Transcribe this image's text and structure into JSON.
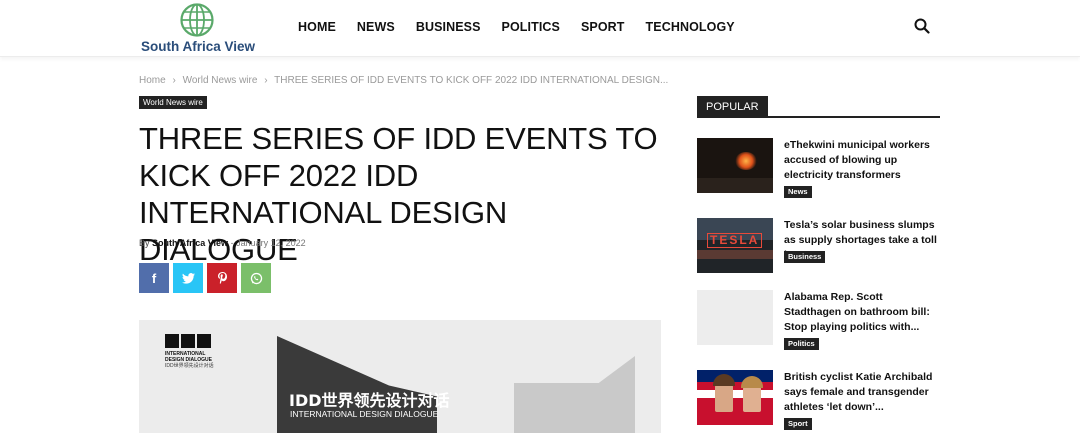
{
  "site": {
    "name": "South Africa View",
    "brand_color": "#2a4d7a",
    "globe_color": "#5aa96a"
  },
  "nav": {
    "items": [
      {
        "label": "HOME"
      },
      {
        "label": "NEWS"
      },
      {
        "label": "BUSINESS"
      },
      {
        "label": "POLITICS"
      },
      {
        "label": "SPORT"
      },
      {
        "label": "TECHNOLOGY"
      }
    ],
    "search_icon": "search-icon"
  },
  "breadcrumb": {
    "items": [
      "Home",
      "World News wire",
      "THREE SERIES OF IDD EVENTS TO KICK OFF 2022 IDD INTERNATIONAL DESIGN..."
    ],
    "separator": "›"
  },
  "article": {
    "category": "World News wire",
    "title": "THREE SERIES OF IDD EVENTS TO KICK OFF 2022 IDD INTERNATIONAL DESIGN DIALOGUE",
    "by_label": "By",
    "author": "South Africa View",
    "date_sep": "-",
    "date": "January 12, 2022",
    "share": [
      {
        "name": "facebook",
        "glyph": "f",
        "color": "#516eab"
      },
      {
        "name": "twitter",
        "glyph": "🐦",
        "color": "#29c5f6"
      },
      {
        "name": "pinterest",
        "glyph": "P",
        "color": "#ca212a"
      },
      {
        "name": "whatsapp",
        "glyph": "✆",
        "color": "#7bbf6a"
      }
    ],
    "feature_image": {
      "logo_line1": "INTERNATIONAL",
      "logo_line2": "DESIGN DIALOGUE",
      "logo_line3": "IDD世界领先设计对话",
      "headline_cn": "IDD世界领先设计对话",
      "headline_en": "INTERNATIONAL DESIGN DIALOGUE"
    }
  },
  "sidebar": {
    "heading": "POPULAR",
    "items": [
      {
        "title": "eThekwini municipal workers accused of blowing up electricity transformers",
        "tag": "News"
      },
      {
        "title": "Tesla’s solar business slumps as supply shortages take a toll |...",
        "tag": "Business",
        "thumb_text": "TESLA"
      },
      {
        "title": "Alabama Rep. Scott Stadthagen on bathroom bill: Stop playing politics with...",
        "tag": "Politics"
      },
      {
        "title": "British cyclist Katie Archibald says female and transgender athletes ‘let down’...",
        "tag": "Sport"
      }
    ]
  }
}
